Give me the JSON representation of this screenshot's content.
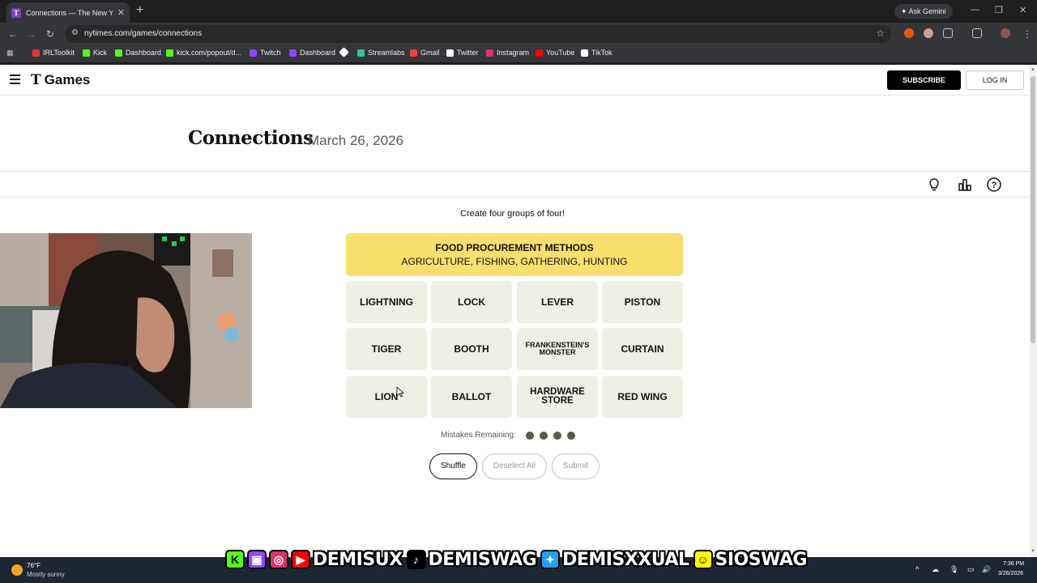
{
  "browser": {
    "tab_title": "Connections — The New York Times",
    "ask_gemini": "Ask Gemini",
    "url": "nytimes.com/games/connections",
    "bookmarks": [
      {
        "label": "IRLToolkit",
        "icon_color": "#e53935"
      },
      {
        "label": "Kick",
        "icon_color": "#53fc18"
      },
      {
        "label": "Dashboard",
        "icon_color": "#53fc18"
      },
      {
        "label": "kick.com/popout/d...",
        "icon_color": "#53fc18"
      },
      {
        "label": "Twitch",
        "icon_color": "#9146ff"
      },
      {
        "label": "Dashboard",
        "icon_color": "#9146ff"
      },
      {
        "label": "",
        "icon_color": "#ffffff"
      },
      {
        "label": "Streamlabs",
        "icon_color": "#31c3a2"
      },
      {
        "label": "Gmail",
        "icon_color": "#ea4335"
      },
      {
        "label": "Twitter",
        "icon_color": "#ffffff"
      },
      {
        "label": "Instagram",
        "icon_color": "#e1306c"
      },
      {
        "label": "YouTube",
        "icon_color": "#ff0000"
      },
      {
        "label": "TikTok",
        "icon_color": "#ffffff"
      }
    ]
  },
  "header": {
    "logo_t": "T",
    "logo_text": "Games",
    "subscribe": "SUBSCRIBE",
    "login": "LOG IN"
  },
  "game": {
    "title": "Connections",
    "date": "March 26, 2026",
    "instructions": "Create four groups of four!",
    "solved": [
      {
        "name": "FOOD PROCUREMENT METHODS",
        "words": "AGRICULTURE, FISHING, GATHERING, HUNTING",
        "color": "#f9df6d"
      }
    ],
    "cards": [
      "LIGHTNING",
      "LOCK",
      "LEVER",
      "PISTON",
      "TIGER",
      "BOOTH",
      "FRANKENSTEIN'S MONSTER",
      "CURTAIN",
      "LION",
      "BALLOT",
      "HARDWARE STORE",
      "RED WING"
    ],
    "mistakes_label": "Mistakes Remaining:",
    "mistakes_remaining": 4,
    "buttons": {
      "shuffle": "Shuffle",
      "deselect": "Deselect All",
      "submit": "Submit"
    }
  },
  "overlay": {
    "handles": [
      "DEMISUX",
      "DEMISWAG",
      "DEMISXXUAL",
      "SIOSWAG"
    ]
  },
  "taskbar": {
    "temperature": "76°F",
    "weather": "Mostly sunny",
    "time": "7:36 PM",
    "date": "3/26/2026"
  }
}
